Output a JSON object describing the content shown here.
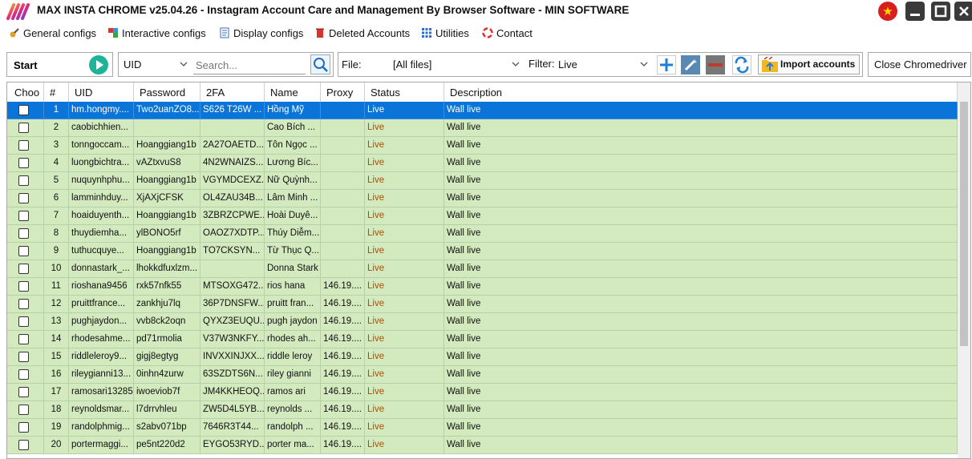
{
  "window": {
    "title": "MAX INSTA CHROME v25.04.26 - Instagram Account Care and Management By Browser Software - MIN SOFTWARE",
    "flag_icon": "vietnam-flag-icon",
    "flag_star": "★"
  },
  "menu": [
    {
      "label": "General configs",
      "icon": "gear-wrench-icon"
    },
    {
      "label": "Interactive configs",
      "icon": "puzzle-icon"
    },
    {
      "label": "Display configs",
      "icon": "display-doc-icon"
    },
    {
      "label": "Deleted Accounts",
      "icon": "trash-icon"
    },
    {
      "label": "Utilities",
      "icon": "grid-icon"
    },
    {
      "label": "Contact",
      "icon": "lifebuoy-icon"
    }
  ],
  "toolbar": {
    "start_label": "Start",
    "field_select": "UID",
    "search_placeholder": "Search...",
    "file_label": "File:",
    "file_select": "[All files]",
    "filter_label": "Filter:",
    "filter_select": "Live",
    "import_label": "Import accounts",
    "close_driver_label": "Close Chromedriver"
  },
  "colors": {
    "row_bg": "#d3eabf",
    "selected_bg": "#0b74d8",
    "status_text": "#b54a00",
    "accent": "#1fb49a"
  },
  "table": {
    "columns": [
      "Choo",
      "#",
      "UID",
      "Password",
      "2FA",
      "Name",
      "Proxy",
      "Status",
      "Description"
    ],
    "rows": [
      {
        "num": "1",
        "uid": "hm.hongmy....",
        "password": "Two2uanZO8...",
        "twofa": "S626 T26W ...",
        "name": "Hồng Mỹ",
        "proxy": "",
        "status": "Live",
        "description": "Wall live",
        "selected": true
      },
      {
        "num": "2",
        "uid": "caobichhien...",
        "password": "",
        "twofa": "",
        "name": "Cao Bích ...",
        "proxy": "",
        "status": "Live",
        "description": "Wall live"
      },
      {
        "num": "3",
        "uid": "tonngoccam...",
        "password": "Hoanggiang1b",
        "twofa": "2A27OAETD...",
        "name": "Tôn Ngọc ...",
        "proxy": "",
        "status": "Live",
        "description": "Wall live"
      },
      {
        "num": "4",
        "uid": "luongbichtra...",
        "password": "vAZtxvuS8",
        "twofa": "4N2WNAIZS...",
        "name": "Lương Bíc...",
        "proxy": "",
        "status": "Live",
        "description": "Wall live"
      },
      {
        "num": "5",
        "uid": "nuquynhphu...",
        "password": "Hoanggiang1b",
        "twofa": "VGYMDCEXZ...",
        "name": "Nữ Quỳnh...",
        "proxy": "",
        "status": "Live",
        "description": "Wall live"
      },
      {
        "num": "6",
        "uid": "lamminhduy...",
        "password": "XjAXjCFSK",
        "twofa": "OL4ZAU34B...",
        "name": "Lâm Minh ...",
        "proxy": "",
        "status": "Live",
        "description": "Wall live"
      },
      {
        "num": "7",
        "uid": "hoaiduyenth...",
        "password": "Hoanggiang1b",
        "twofa": "3ZBRZCPWE...",
        "name": "Hoài Duyê...",
        "proxy": "",
        "status": "Live",
        "description": "Wall live"
      },
      {
        "num": "8",
        "uid": "thuydiemha...",
        "password": "ylBONO5rf",
        "twofa": "OAOZ7XDTP...",
        "name": "Thúy Diễm...",
        "proxy": "",
        "status": "Live",
        "description": "Wall live"
      },
      {
        "num": "9",
        "uid": "tuthucquye...",
        "password": "Hoanggiang1b",
        "twofa": "TO7CKSYN...",
        "name": "Từ Thục Q...",
        "proxy": "",
        "status": "Live",
        "description": "Wall live"
      },
      {
        "num": "10",
        "uid": "donnastark_...",
        "password": "lhokkdfuxlzm...",
        "twofa": "",
        "name": "Donna Stark",
        "proxy": "",
        "status": "Live",
        "description": "Wall live"
      },
      {
        "num": "11",
        "uid": "rioshana9456",
        "password": "rxk57nfk55",
        "twofa": "MTSOXG472...",
        "name": "rios hana",
        "proxy": "146.19....",
        "status": "Live",
        "description": "Wall live"
      },
      {
        "num": "12",
        "uid": "pruittfrance...",
        "password": "zankhju7lq",
        "twofa": "36P7DNSFW...",
        "name": "pruitt fran...",
        "proxy": "146.19....",
        "status": "Live",
        "description": "Wall live"
      },
      {
        "num": "13",
        "uid": "pughjaydon...",
        "password": "vvb8ck2oqn",
        "twofa": "QYXZ3EUQU...",
        "name": "pugh jaydon",
        "proxy": "146.19....",
        "status": "Live",
        "description": "Wall live"
      },
      {
        "num": "14",
        "uid": "rhodesahme...",
        "password": "pd71rmolia",
        "twofa": "V37W3NKFY...",
        "name": "rhodes ah...",
        "proxy": "146.19....",
        "status": "Live",
        "description": "Wall live"
      },
      {
        "num": "15",
        "uid": "riddleleroy9...",
        "password": "gigj8egtyg",
        "twofa": "INVXXINJXX...",
        "name": "riddle leroy",
        "proxy": "146.19....",
        "status": "Live",
        "description": "Wall live"
      },
      {
        "num": "16",
        "uid": "rileygianni13...",
        "password": "0inhn4zurw",
        "twofa": "63SZDTS6N...",
        "name": "riley gianni",
        "proxy": "146.19....",
        "status": "Live",
        "description": "Wall live"
      },
      {
        "num": "17",
        "uid": "ramosari13285",
        "password": "iwoeviob7f",
        "twofa": "JM4KKHEOQ...",
        "name": "ramos ari",
        "proxy": "146.19....",
        "status": "Live",
        "description": "Wall live"
      },
      {
        "num": "18",
        "uid": "reynoldsmar...",
        "password": "l7drrvhleu",
        "twofa": "ZW5D4L5YB...",
        "name": "reynolds ...",
        "proxy": "146.19....",
        "status": "Live",
        "description": "Wall live"
      },
      {
        "num": "19",
        "uid": "randolphmig...",
        "password": "s2abv071bp",
        "twofa": "7646R3T44...",
        "name": "randolph ...",
        "proxy": "146.19....",
        "status": "Live",
        "description": "Wall live"
      },
      {
        "num": "20",
        "uid": "portermaggi...",
        "password": "pe5nt220d2",
        "twofa": "EYGO53RYD...",
        "name": "porter ma...",
        "proxy": "146.19....",
        "status": "Live",
        "description": "Wall live"
      }
    ]
  }
}
